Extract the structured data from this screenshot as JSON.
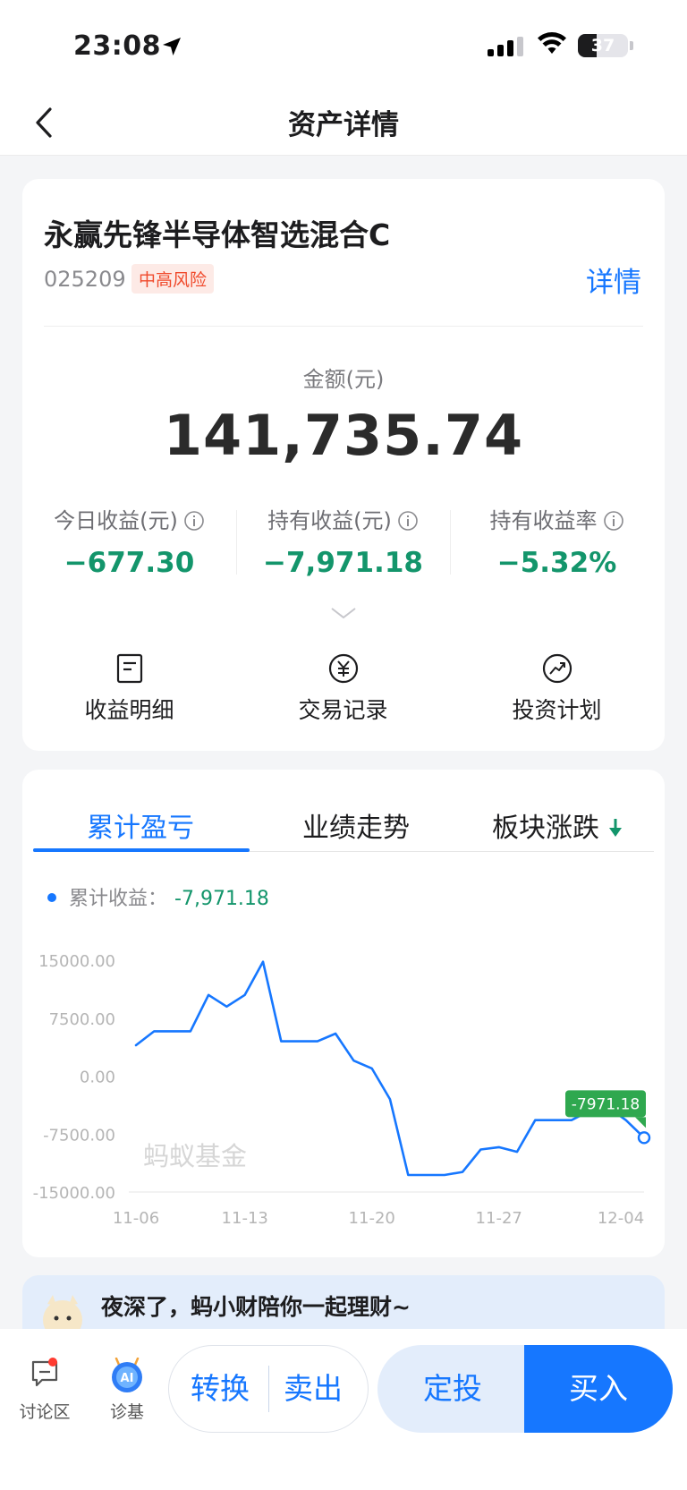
{
  "status_bar": {
    "time": "23:08",
    "battery": "37",
    "battery_level": 0.37
  },
  "nav": {
    "title": "资产详情"
  },
  "fund": {
    "name": "永赢先锋半导体智选混合C",
    "code": "025209",
    "risk": "中高风险",
    "detail_link": "详情"
  },
  "amount": {
    "label": "金额(元)",
    "value": "141,735.74"
  },
  "stats": [
    {
      "label": "今日收益(元)",
      "value": "−677.30"
    },
    {
      "label": "持有收益(元)",
      "value": "−7,971.18"
    },
    {
      "label": "持有收益率",
      "value": "−5.32%"
    }
  ],
  "quick_actions": [
    {
      "label": "收益明细",
      "icon": "doc-icon"
    },
    {
      "label": "交易记录",
      "icon": "yuan-icon"
    },
    {
      "label": "投资计划",
      "icon": "trend-icon"
    }
  ],
  "tabs": [
    {
      "label": "累计盈亏",
      "active": true
    },
    {
      "label": "业绩走势",
      "active": false
    },
    {
      "label": "板块涨跌",
      "active": false
    }
  ],
  "colors": {
    "accent": "#1677ff",
    "loss_green": "#13956b",
    "label_green": "#2fa84f"
  },
  "chart_data": {
    "type": "line",
    "legend_label": "累计收益：",
    "legend_value": "-7,971.18",
    "watermark": "蚂蚁基金",
    "y_ticks": [
      "15000.00",
      "7500.00",
      "0.00",
      "-7500.00",
      "-15000.00"
    ],
    "ylim": [
      -15000,
      15000
    ],
    "x_ticks": [
      {
        "label": "11-06",
        "index": 0
      },
      {
        "label": "11-13",
        "index": 6
      },
      {
        "label": "11-20",
        "index": 13
      },
      {
        "label": "11-27",
        "index": 20
      },
      {
        "label": "12-04",
        "index": 28
      }
    ],
    "n_points": 29,
    "values": [
      4000,
      5800,
      5800,
      5800,
      10500,
      9000,
      10500,
      14800,
      4500,
      4500,
      4500,
      5500,
      2000,
      1000,
      -3000,
      -12800,
      -12800,
      -12800,
      -12400,
      -9500,
      -9200,
      -9800,
      -5700,
      -5700,
      -5700,
      -4500,
      -4000,
      -5700,
      -7971.18
    ],
    "last_label": "-7971.18",
    "grid": false
  },
  "promo": {
    "text": "夜深了，蚂小财陪你一起理财~"
  },
  "bottom": {
    "discuss": "讨论区",
    "diagnose": "诊基",
    "convert": "转换",
    "sell": "卖出",
    "sip": "定投",
    "buy": "买入"
  }
}
